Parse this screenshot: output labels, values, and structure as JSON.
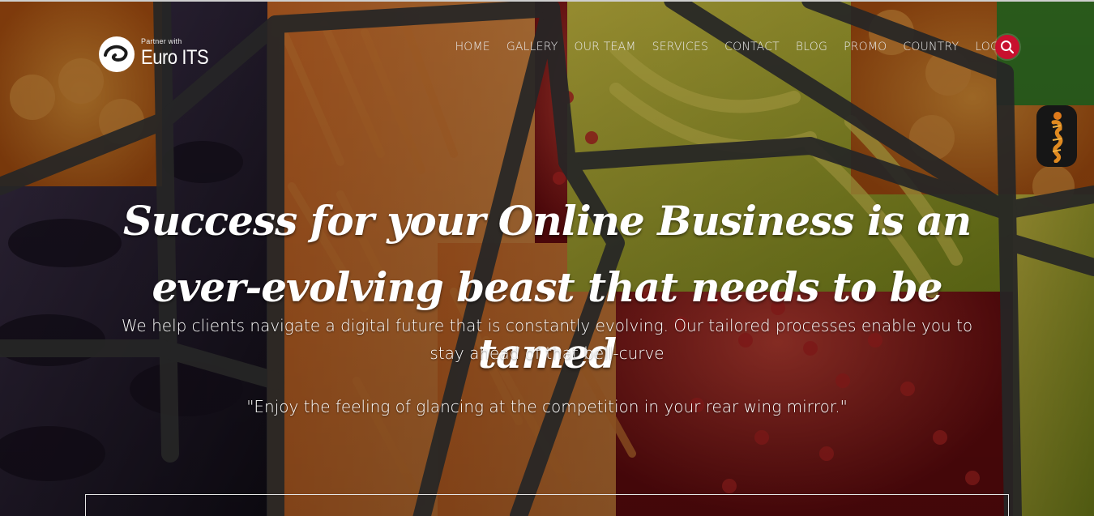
{
  "logo": {
    "tagline": "Partner with",
    "name": "Euro ITS"
  },
  "nav": {
    "items": [
      {
        "label": "HOME"
      },
      {
        "label": "GALLERY"
      },
      {
        "label": "OUR TEAM"
      },
      {
        "label": "SERVICES"
      },
      {
        "label": "CONTACT"
      },
      {
        "label": "BLOG"
      },
      {
        "label": "PROMO"
      },
      {
        "label": "COUNTRY"
      },
      {
        "label": "LOGIN"
      }
    ],
    "search_icon": "search-icon"
  },
  "hero": {
    "headline": "Success for your Online Business is an ever-evolving beast that needs to be tamed",
    "subtext": "We help clients navigate a digital future that is constantly evolving. Our tailored processes enable you to stay ahead of that bell-curve",
    "quote": "\"Enjoy the feeling of glancing at the competition in your rear wing mirror.\""
  },
  "colors": {
    "accent": "#c8102e",
    "text": "#ffffff"
  }
}
